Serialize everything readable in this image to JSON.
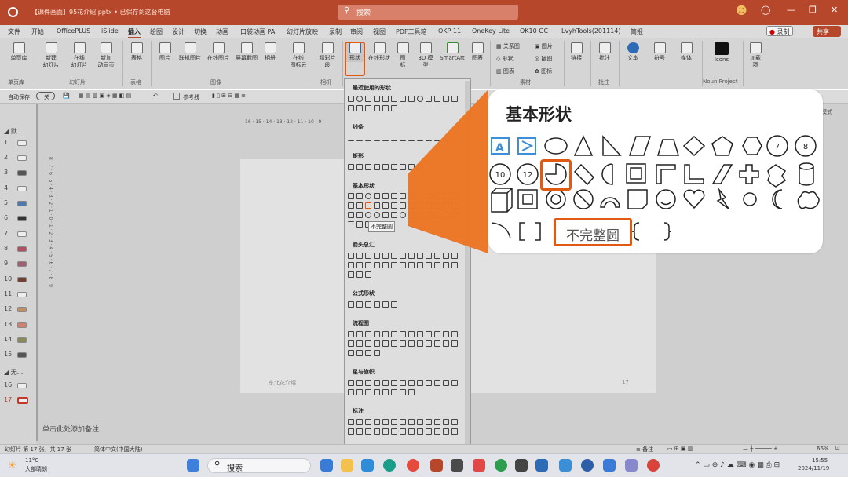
{
  "window": {
    "title": "【课件画面】95花介绍.pptx • 已保存到这台电脑",
    "search_placeholder": "搜索"
  },
  "menu": [
    "文件",
    "开始",
    "OfficePLUS",
    "iSlide",
    "插入",
    "绘图",
    "设计",
    "切换",
    "动画",
    "口袋动画 PA",
    "幻灯片放映",
    "录制",
    "审阅",
    "视图",
    "PDF工具箱",
    "OKP 11",
    "OneKey Lite",
    "OK10 GC",
    "LvyhTools(201114)",
    "简报"
  ],
  "menu_active": "插入",
  "record_label": "录制",
  "share_label": "共享",
  "ribbon": {
    "buttons": [
      {
        "label": "单页库",
        "group": "单页库"
      },
      {
        "label": "新建\n幻灯片",
        "group": "幻灯片"
      },
      {
        "label": "在线\n幻灯片",
        "group": "幻灯片"
      },
      {
        "label": "新加\n动画页",
        "group": "幻灯片"
      },
      {
        "label": "表格",
        "group": "表格"
      },
      {
        "label": "图片",
        "group": "图像"
      },
      {
        "label": "联机图片",
        "group": "图像"
      },
      {
        "label": "在线图片",
        "group": "图像"
      },
      {
        "label": "屏幕截图",
        "group": "图像"
      },
      {
        "label": "相册",
        "group": "图像"
      },
      {
        "label": "在线\n图标云",
        "group": ""
      },
      {
        "label": "精彩片\n段",
        "group": "相机"
      },
      {
        "label": "形状",
        "group": ""
      },
      {
        "label": "在线形状",
        "group": ""
      },
      {
        "label": "图\n标",
        "group": ""
      },
      {
        "label": "3D 模\n型",
        "group": ""
      },
      {
        "label": "SmartArt",
        "group": ""
      },
      {
        "label": "图表",
        "group": ""
      },
      {
        "label": "批注",
        "group": "批注"
      },
      {
        "label": "文本",
        "group": ""
      },
      {
        "label": "符号",
        "group": ""
      },
      {
        "label": "媒体",
        "group": ""
      },
      {
        "label": "Icons",
        "group": "Noun Project"
      },
      {
        "label": "加载\n项",
        "group": ""
      }
    ],
    "small_buttons": [
      "关系图",
      "形状",
      "图表",
      "图片",
      "插图",
      "图标",
      "链接"
    ],
    "groups": [
      "单页库",
      "幻灯片",
      "表格",
      "图像",
      "相机",
      "素材",
      "批注",
      "Noun Project"
    ]
  },
  "qat": {
    "autosave": "自动保存",
    "autosave_state": "关",
    "reference_line": "参考线"
  },
  "ruler_top": "16 · 15 · 14 · 13 · 12 · 11 · 10 · 9",
  "ruler_left": "8 · 7 · 6 · 5 · 4 · 3 · 2 · 1 · 0 · 1 · 2 · 3 · 4 · 5 · 6 · 7 · 8 · 9",
  "right_label": "模式",
  "thumbnails": {
    "section1": "默...",
    "section2": "无...",
    "numbers": [
      "1",
      "2",
      "3",
      "4",
      "5",
      "6",
      "7",
      "8",
      "9",
      "10",
      "11",
      "12",
      "13",
      "14",
      "15",
      "16",
      "17"
    ],
    "selected": "17"
  },
  "slide": {
    "footer_left": "东北花介绍",
    "page_num": "17"
  },
  "notes_placeholder": "单击此处添加备注",
  "dropdown": {
    "sections": [
      "最近使用的形状",
      "线条",
      "矩形",
      "基本形状",
      "箭头总汇",
      "公式形状",
      "流程图",
      "星与旗帜",
      "标注"
    ],
    "tooltip": "不完整圆"
  },
  "zoom": {
    "heading": "基本形状",
    "tooltip": "不完整圆",
    "octagon_10": "10",
    "dodecagon_12": "12",
    "heptagon_7": "7",
    "octagon_8": "8",
    "textbox_a": "A"
  },
  "status": {
    "slide_info": "幻灯片 第 17 张，共 17 张",
    "language": "简体中文(中国大陆)",
    "notes": "备注",
    "zoom_level": "66%"
  },
  "taskbar": {
    "weather_temp": "11°C",
    "weather_desc": "大部晴朗",
    "search": "搜索",
    "time": "15:55",
    "date": "2024/11/19"
  },
  "colors": {
    "accent": "#b7472a",
    "highlight": "#e05a14",
    "shape_blue": "#3a8fd6"
  }
}
